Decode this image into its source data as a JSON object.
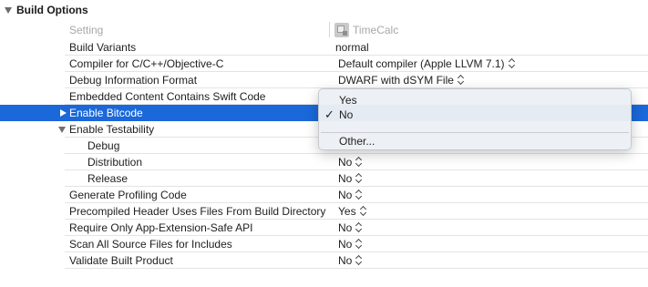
{
  "section": {
    "title": "Build Options"
  },
  "columns": {
    "setting": "Setting",
    "target": "TimeCalc"
  },
  "rows": [
    {
      "label": "Build Variants",
      "value": "normal",
      "stepper": false
    },
    {
      "label": "Compiler for C/C++/Objective-C",
      "value": "Default compiler (Apple LLVM 7.1)",
      "stepper": true
    },
    {
      "label": "Debug Information Format",
      "value": "DWARF with dSYM File",
      "stepper": true
    },
    {
      "label": "Embedded Content Contains Swift Code",
      "value": "",
      "stepper": false
    },
    {
      "label": "Enable Bitcode",
      "value": "",
      "stepper": false,
      "selected": true
    },
    {
      "label": "Enable Testability",
      "value": "",
      "stepper": false
    },
    {
      "label": "Debug",
      "value": "",
      "stepper": false
    },
    {
      "label": "Distribution",
      "value": "No",
      "stepper": true
    },
    {
      "label": "Release",
      "value": "No",
      "stepper": true
    },
    {
      "label": "Generate Profiling Code",
      "value": "No",
      "stepper": true
    },
    {
      "label": "Precompiled Header Uses Files From Build Directory",
      "value": "Yes",
      "stepper": true
    },
    {
      "label": "Require Only App-Extension-Safe API",
      "value": "No",
      "stepper": true
    },
    {
      "label": "Scan All Source Files for Includes",
      "value": "No",
      "stepper": true
    },
    {
      "label": "Validate Built Product",
      "value": "No",
      "stepper": true
    }
  ],
  "popup": {
    "options": [
      "Yes",
      "No"
    ],
    "selected": "No",
    "other": "Other...",
    "check_mark": "✓"
  },
  "colors": {
    "selection": "#1a68d9",
    "popup_bg": "#ecf0f4"
  }
}
